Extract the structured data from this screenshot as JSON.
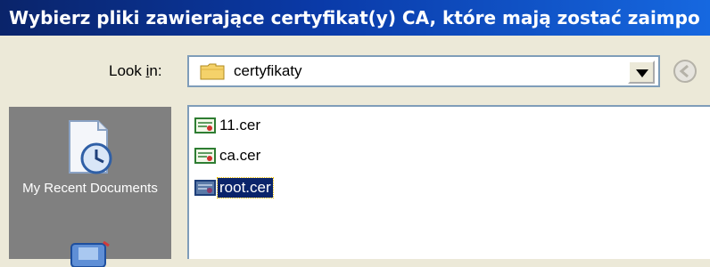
{
  "dialog": {
    "title": "Wybierz pliki zawierające certyfikat(y) CA, które mają zostać zaimpo"
  },
  "lookin": {
    "label": "Look in:",
    "value": "certyfikaty"
  },
  "places": {
    "recent_label": "My Recent Documents"
  },
  "files": [
    {
      "name": "11.cer",
      "selected": false
    },
    {
      "name": "ca.cer",
      "selected": false
    },
    {
      "name": "root.cer",
      "selected": true
    }
  ]
}
